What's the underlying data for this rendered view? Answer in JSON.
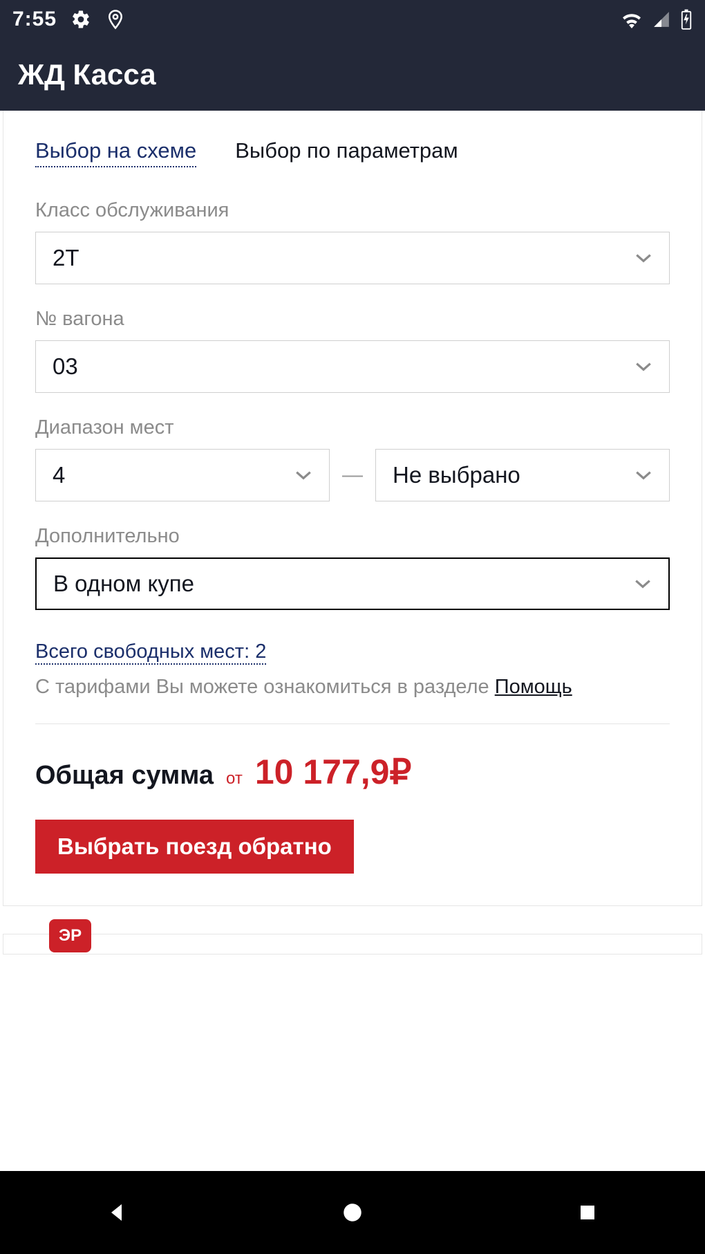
{
  "status": {
    "time": "7:55"
  },
  "app": {
    "title": "ЖД Касса"
  },
  "tabs": {
    "scheme": "Выбор на схеме",
    "params": "Выбор по параметрам"
  },
  "fields": {
    "service_class": {
      "label": "Класс обслуживания",
      "value": "2Т"
    },
    "wagon_number": {
      "label": "№ вагона",
      "value": "03"
    },
    "seat_range": {
      "label": "Диапазон мест",
      "from": "4",
      "to": "Не выбрано",
      "dash": "—"
    },
    "extra": {
      "label": "Дополнительно",
      "value": "В одном купе"
    }
  },
  "info": {
    "free_seats": "Всего свободных мест: 2",
    "tariff_note_pre": "С тарифами Вы можете ознакомиться в разделе ",
    "help_link": "Помощь"
  },
  "total": {
    "label": "Общая сумма",
    "from": "от",
    "amount": "10 177,9₽"
  },
  "actions": {
    "select_return": "Выбрать поезд обратно"
  },
  "badge": {
    "er": "ЭР"
  },
  "colors": {
    "accent": "#cc2128",
    "navy": "#1b2f6b",
    "header": "#232838"
  }
}
